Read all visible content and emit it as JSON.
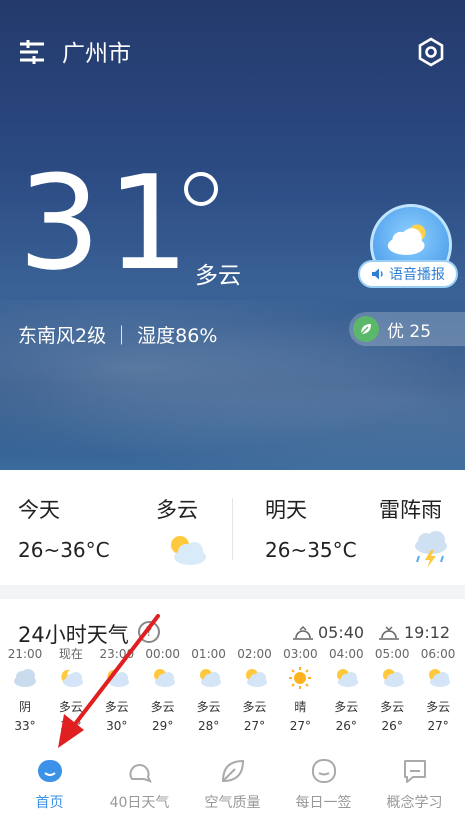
{
  "header": {
    "city": "广州市"
  },
  "current": {
    "temperature": "31",
    "condition": "多云",
    "wind_humidity": "东南风2级 ｜ 湿度86%",
    "voice_label": "语音播报",
    "aqi_label": "优 25"
  },
  "days": [
    {
      "name": "今天",
      "condition": "多云",
      "range": "26~36°C",
      "icon": "partly-cloudy-icon"
    },
    {
      "name": "明天",
      "condition": "雷阵雨",
      "range": "26~35°C",
      "icon": "thunderstorm-icon"
    }
  ],
  "hourly": {
    "title": "24小时天气",
    "sunrise": "05:40",
    "sunset": "19:12",
    "items": [
      {
        "time": "21:00",
        "cond": "阴",
        "temp": "33°",
        "icon": "cloud-icon"
      },
      {
        "time": "现在",
        "cond": "多云",
        "temp": "31°",
        "icon": "partly-cloudy-night-icon"
      },
      {
        "time": "23:00",
        "cond": "多云",
        "temp": "30°",
        "icon": "partly-cloudy-night-icon"
      },
      {
        "time": "00:00",
        "cond": "多云",
        "temp": "29°",
        "icon": "partly-cloudy-icon"
      },
      {
        "time": "01:00",
        "cond": "多云",
        "temp": "28°",
        "icon": "partly-cloudy-icon"
      },
      {
        "time": "02:00",
        "cond": "多云",
        "temp": "27°",
        "icon": "partly-cloudy-icon"
      },
      {
        "time": "03:00",
        "cond": "晴",
        "temp": "27°",
        "icon": "sun-icon"
      },
      {
        "time": "04:00",
        "cond": "多云",
        "temp": "26°",
        "icon": "partly-cloudy-icon"
      },
      {
        "time": "05:00",
        "cond": "多云",
        "temp": "26°",
        "icon": "partly-cloudy-icon"
      },
      {
        "time": "06:00",
        "cond": "多云",
        "temp": "27°",
        "icon": "partly-cloudy-icon"
      }
    ]
  },
  "tabs": [
    {
      "label": "首页",
      "icon": "home-icon",
      "active": true
    },
    {
      "label": "40日天气",
      "icon": "forecast-icon",
      "active": false
    },
    {
      "label": "空气质量",
      "icon": "leaf-icon",
      "active": false
    },
    {
      "label": "每日一签",
      "icon": "face-icon",
      "active": false
    },
    {
      "label": "概念学习",
      "icon": "chat-icon",
      "active": false
    }
  ],
  "colors": {
    "accent": "#3b92e8",
    "hero_top": "#243a6c",
    "arrow": "#e02020"
  }
}
